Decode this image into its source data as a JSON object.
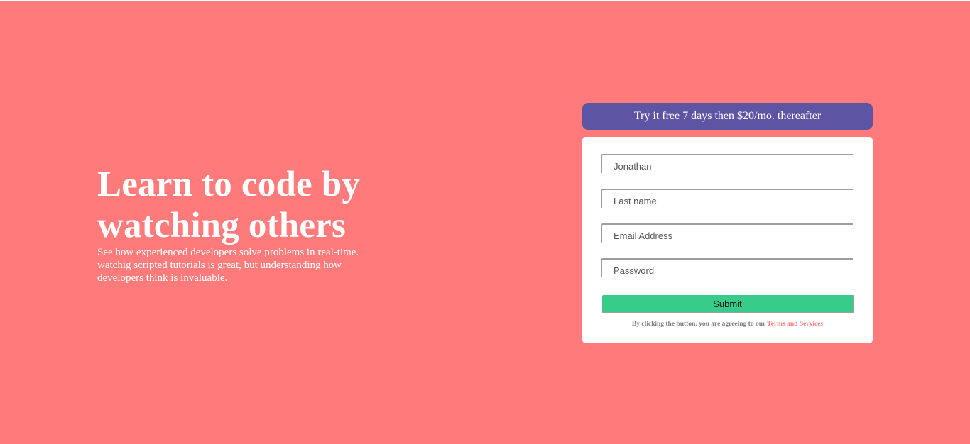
{
  "colors": {
    "background": "#ff7a7a",
    "promo": "#5e54a4",
    "submit": "#38cc8b",
    "card": "#ffffff",
    "terms_link": "#ff7a7a"
  },
  "hero": {
    "title": "Learn to code by watching others",
    "description": "See how experienced developers solve problems in real-time. watchig scripted tutorials is great, but understanding how developers think is invaluable."
  },
  "promo": {
    "text": "Try it free 7 days then $20/mo. thereafter"
  },
  "form": {
    "first_name": {
      "value": "",
      "placeholder": "Jonathan"
    },
    "last_name": {
      "value": "",
      "placeholder": "Last name"
    },
    "email": {
      "value": "",
      "placeholder": "Email Address"
    },
    "password": {
      "value": "",
      "placeholder": "Password"
    },
    "submit_label": "Submit",
    "terms_prefix": "By clicking the button, you are agreeing to our",
    "terms_link": "Terms and Services"
  }
}
